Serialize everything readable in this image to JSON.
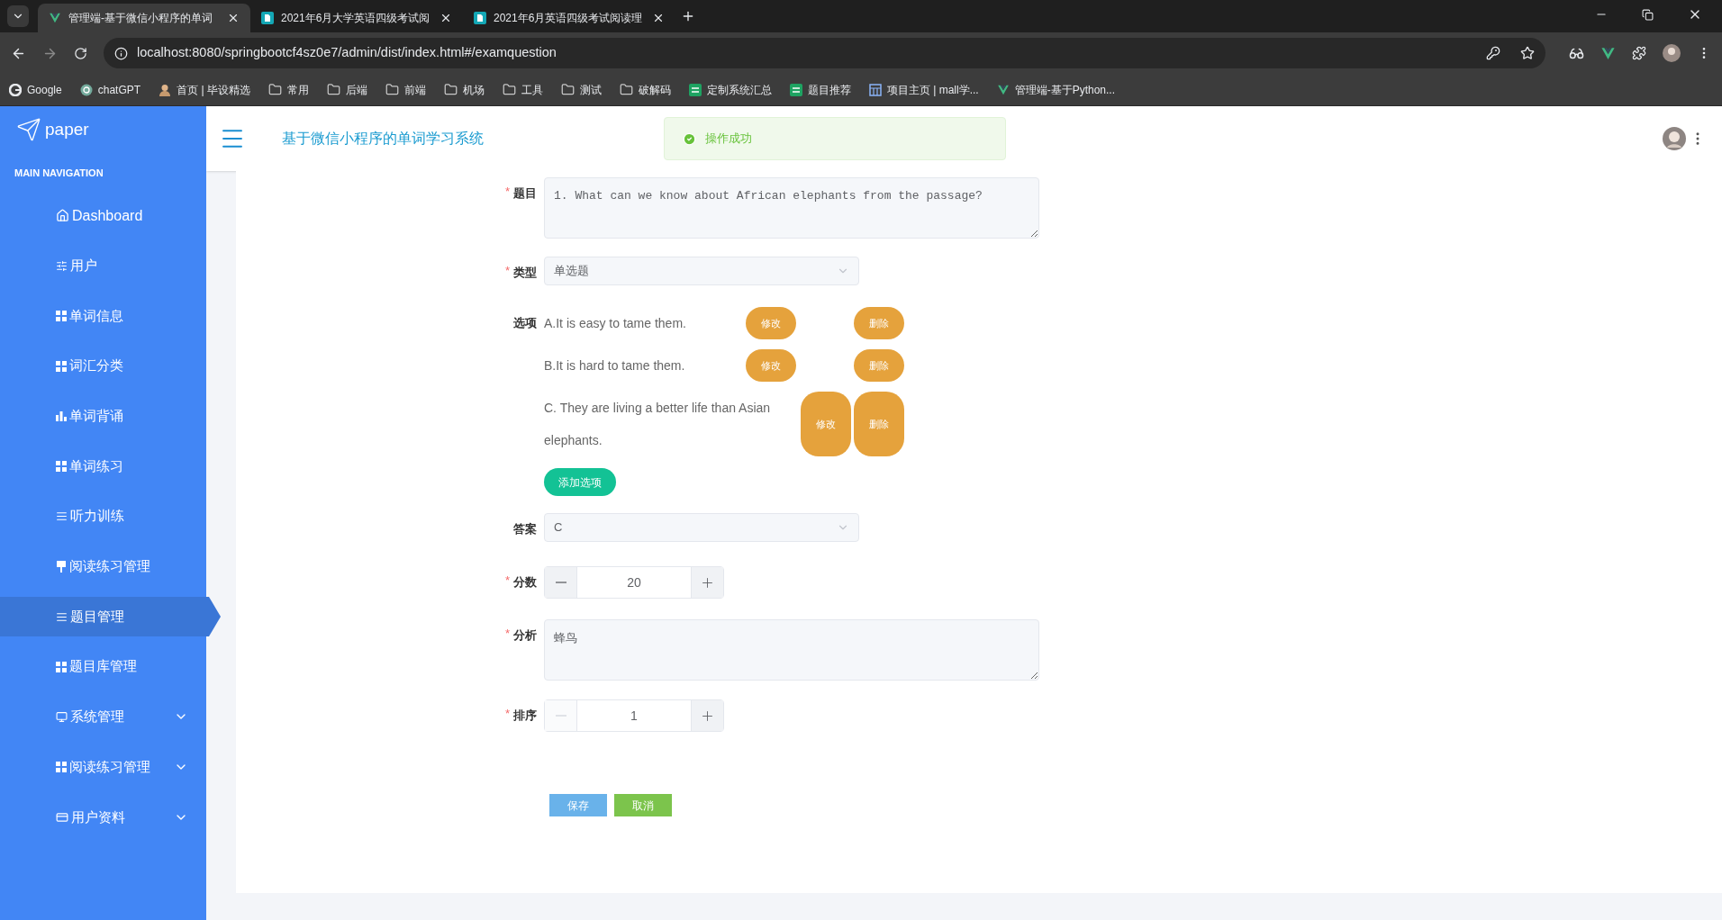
{
  "browser": {
    "tabs": [
      {
        "title": "管理端-基于微信小程序的单词",
        "selected": true,
        "kind": "vue"
      },
      {
        "title": "2021年6月大学英语四级考试阅",
        "selected": false,
        "kind": "doc"
      },
      {
        "title": "2021年6月英语四级考试阅读理",
        "selected": false,
        "kind": "doc"
      }
    ],
    "address": "localhost:8080/springbootcf4sz0e7/admin/dist/index.html#/examquestion",
    "bookmarks": [
      {
        "label": "Google",
        "kind": "google"
      },
      {
        "label": "chatGPT",
        "kind": "gpt"
      },
      {
        "label": "首页 | 毕设精选",
        "kind": "person"
      },
      {
        "label": "常用",
        "kind": "folder"
      },
      {
        "label": "后端",
        "kind": "folder"
      },
      {
        "label": "前端",
        "kind": "folder"
      },
      {
        "label": "机场",
        "kind": "folder"
      },
      {
        "label": "工具",
        "kind": "folder"
      },
      {
        "label": "测试",
        "kind": "folder"
      },
      {
        "label": "破解码",
        "kind": "folder"
      },
      {
        "label": "定制系统汇总",
        "kind": "sheet"
      },
      {
        "label": "题目推荐",
        "kind": "sheet"
      },
      {
        "label": "项目主页 | mall学...",
        "kind": "site"
      },
      {
        "label": "管理端-基于Python...",
        "kind": "vue"
      }
    ]
  },
  "sidebar": {
    "logo": "paper",
    "heading": "MAIN NAVIGATION",
    "items": [
      {
        "label": "Dashboard",
        "selected": false,
        "expandable": false
      },
      {
        "label": "用户",
        "selected": false,
        "expandable": false
      },
      {
        "label": "单词信息",
        "selected": false,
        "expandable": false
      },
      {
        "label": "词汇分类",
        "selected": false,
        "expandable": false
      },
      {
        "label": "单词背诵",
        "selected": false,
        "expandable": false
      },
      {
        "label": "单词练习",
        "selected": false,
        "expandable": false
      },
      {
        "label": "听力训练",
        "selected": false,
        "expandable": false
      },
      {
        "label": "阅读练习管理",
        "selected": false,
        "expandable": false
      },
      {
        "label": "题目管理",
        "selected": true,
        "expandable": false
      },
      {
        "label": "题目库管理",
        "selected": false,
        "expandable": false
      },
      {
        "label": "系统管理",
        "selected": false,
        "expandable": true
      },
      {
        "label": "阅读练习管理",
        "selected": false,
        "expandable": true
      },
      {
        "label": "用户资料",
        "selected": false,
        "expandable": true
      }
    ]
  },
  "header": {
    "title": "基于微信小程序的单词学习系统",
    "toast": "操作成功"
  },
  "form": {
    "fields": [
      {
        "kind": "textarea",
        "label": "题目",
        "required_mark": "*",
        "value": "1. What can we know about African elephants from the passage?"
      },
      {
        "kind": "select",
        "label": "类型",
        "required_mark": "*",
        "value": "单选题"
      },
      {
        "kind": "options",
        "label": "选项",
        "options": [
          {
            "text": "A.It is easy to tame them.",
            "edit": "修改",
            "delete": "删除"
          },
          {
            "text": "B.It is hard to tame them.",
            "edit": "修改",
            "delete": "删除"
          },
          {
            "text": "C. They are living a better life than Asian elephants.",
            "edit": "修改",
            "delete": "删除"
          }
        ],
        "add": "添加选项"
      },
      {
        "kind": "select",
        "label": "答案",
        "value": "C"
      },
      {
        "kind": "number",
        "label": "分数",
        "required_mark": "*",
        "value": "20",
        "decrement_disabled": false
      },
      {
        "kind": "textarea",
        "label": "分析",
        "required_mark": "*",
        "value": "蜂鸟"
      },
      {
        "kind": "number",
        "label": "排序",
        "required_mark": "*",
        "value": "1",
        "decrement_disabled": true
      }
    ],
    "save": "保存",
    "cancel": "取消"
  }
}
